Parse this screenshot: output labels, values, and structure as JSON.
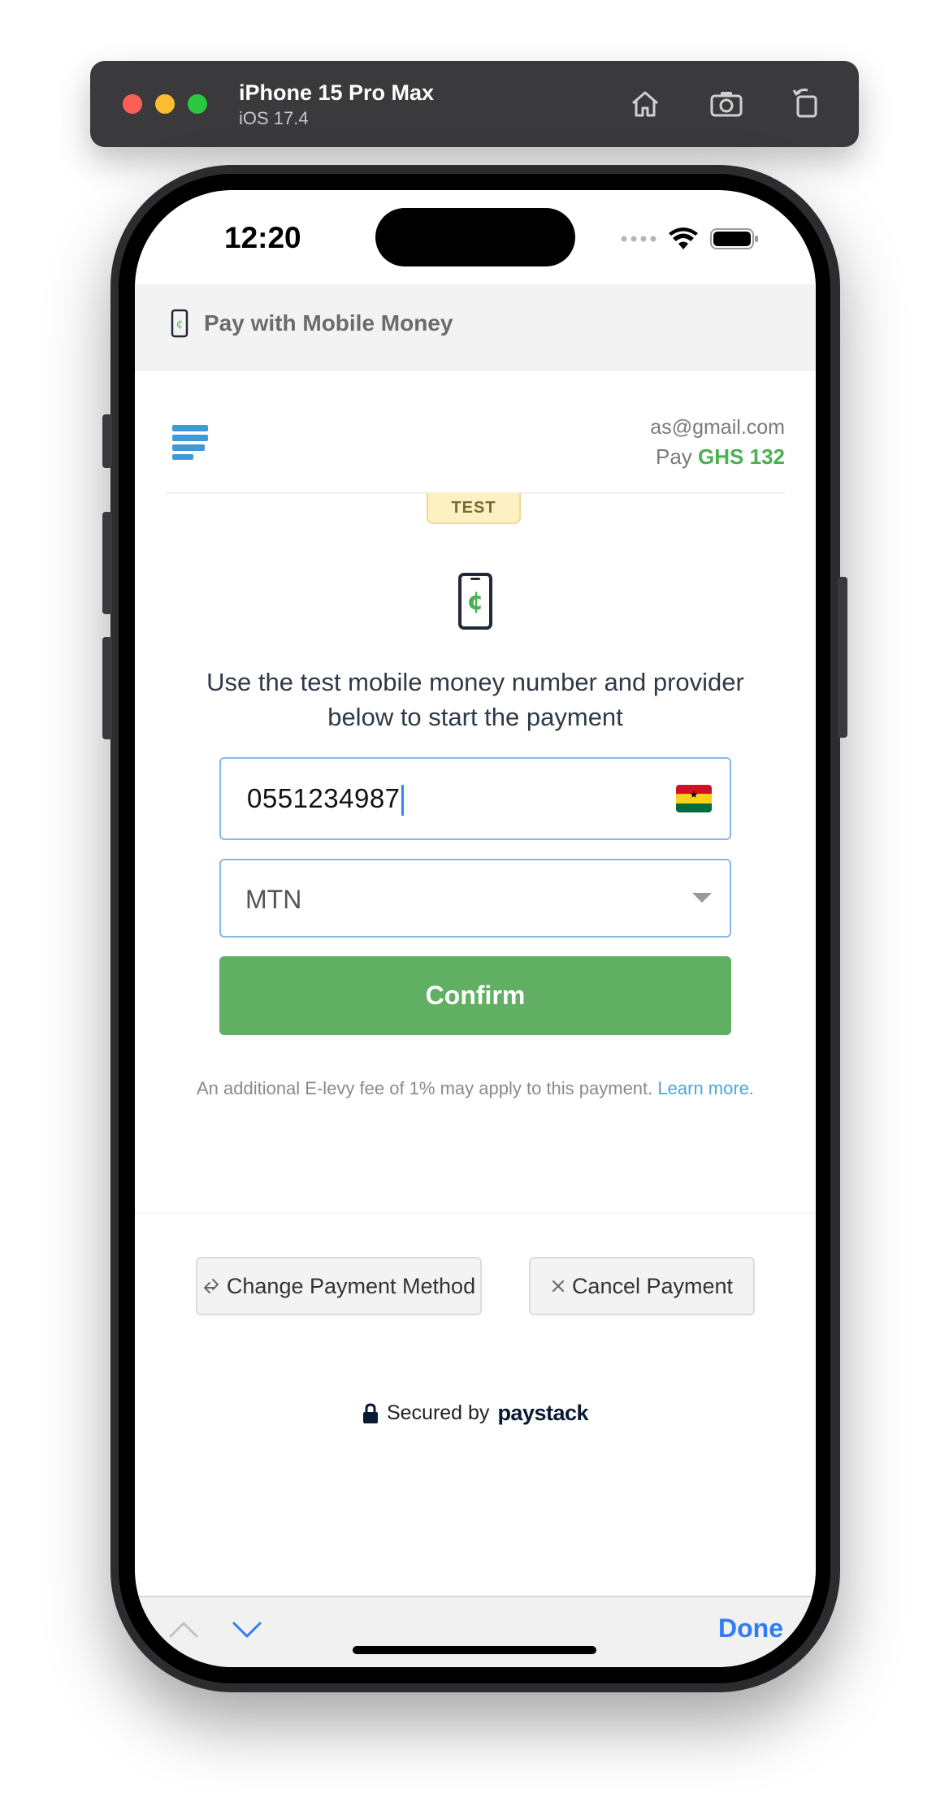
{
  "simulator": {
    "device": "iPhone 15 Pro Max",
    "os": "iOS 17.4",
    "buttons": [
      "home-icon",
      "screenshot-icon",
      "rotate-icon"
    ]
  },
  "status_bar": {
    "time": "12:20"
  },
  "nav": {
    "title": "Pay with Mobile Money",
    "icon": "mobile-money-icon"
  },
  "header": {
    "email": "as@gmail.com",
    "pay_label": "Pay",
    "amount": "GHS 132"
  },
  "badge": {
    "label": "TEST"
  },
  "instruction": "Use the test mobile money number and provider below to start the payment",
  "phone_field": {
    "value": "0551234987",
    "flag": "ghana-flag-icon"
  },
  "provider_select": {
    "value": "MTN"
  },
  "confirm_label": "Confirm",
  "levy": {
    "text": "An additional E-levy fee of 1% may apply to this payment.",
    "link": "Learn more."
  },
  "actions": {
    "change": "Change Payment Method",
    "cancel": "Cancel Payment"
  },
  "secured": {
    "label": "Secured by",
    "brand": "paystack"
  },
  "keyboard_bar": {
    "done": "Done"
  },
  "colors": {
    "accent_green": "#60af63",
    "link_blue": "#4aa7da",
    "field_border": "#8ab8e6",
    "done_blue": "#2f7cf6"
  }
}
